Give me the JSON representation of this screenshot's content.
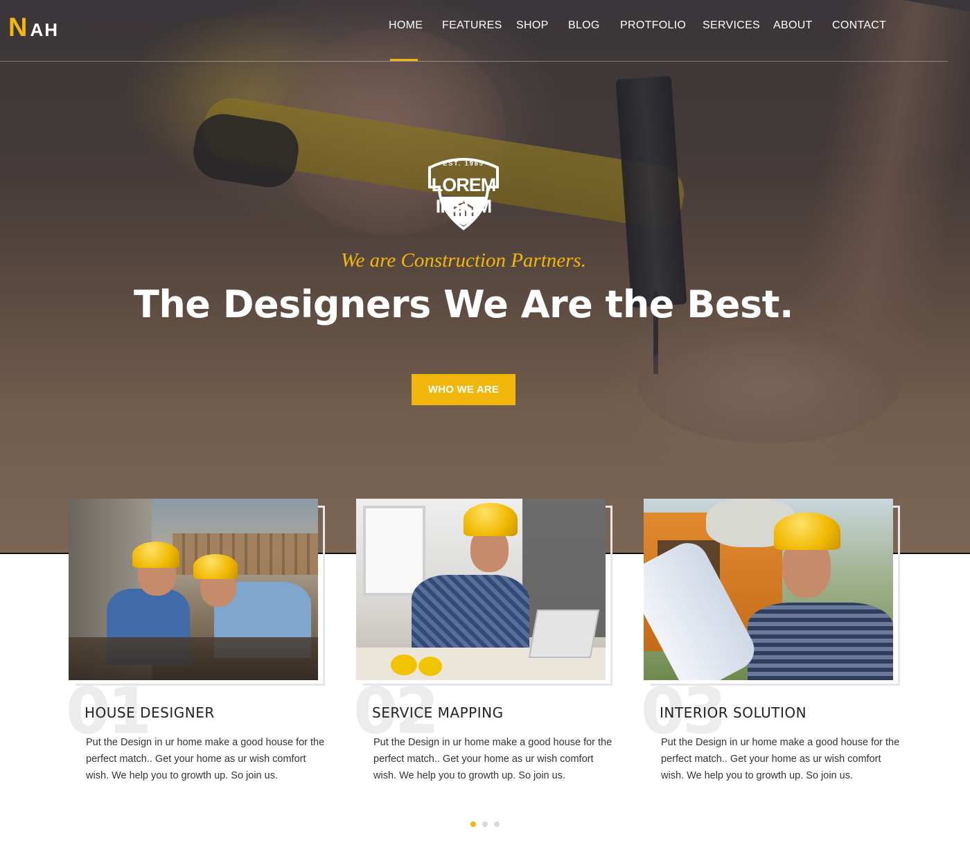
{
  "brand": {
    "logo_initial": "N",
    "logo_rest": "AH",
    "accent": "#f1b70d"
  },
  "nav": {
    "items": [
      {
        "label": "HOME",
        "active": true
      },
      {
        "label": "FEATURES"
      },
      {
        "label": "SHOP"
      },
      {
        "label": "BLOG"
      },
      {
        "label": "PROTFOLIO"
      },
      {
        "label": "SERVICES"
      },
      {
        "label": "ABOUT"
      },
      {
        "label": "CONTACT"
      }
    ]
  },
  "hero": {
    "badge_est": "EST. 1985",
    "badge_title": "LOREM IPSUM",
    "tagline": "We are Construction Partners.",
    "headline": "The Designers We Are the Best.",
    "cta_label": "WHO WE ARE"
  },
  "cards": [
    {
      "number": "01",
      "title": "HOUSE DESIGNER",
      "text": "Put the Design in ur home make a good house for the perfect match.. Get your home as ur wish comfort wish. We help you to growth up. So join us."
    },
    {
      "number": "02",
      "title": "SERVICE MAPPING",
      "text": "Put the Design in ur home make a good house for the perfect match.. Get your home as ur wish comfort wish. We help you to growth up. So join us."
    },
    {
      "number": "03",
      "title": "INTERIOR SOLUTION",
      "text": "Put the Design in ur home make a good house for the perfect match.. Get your home as ur wish comfort wish. We help you to growth up. So join us."
    }
  ],
  "carousel": {
    "pages": 3,
    "active_index": 0
  }
}
